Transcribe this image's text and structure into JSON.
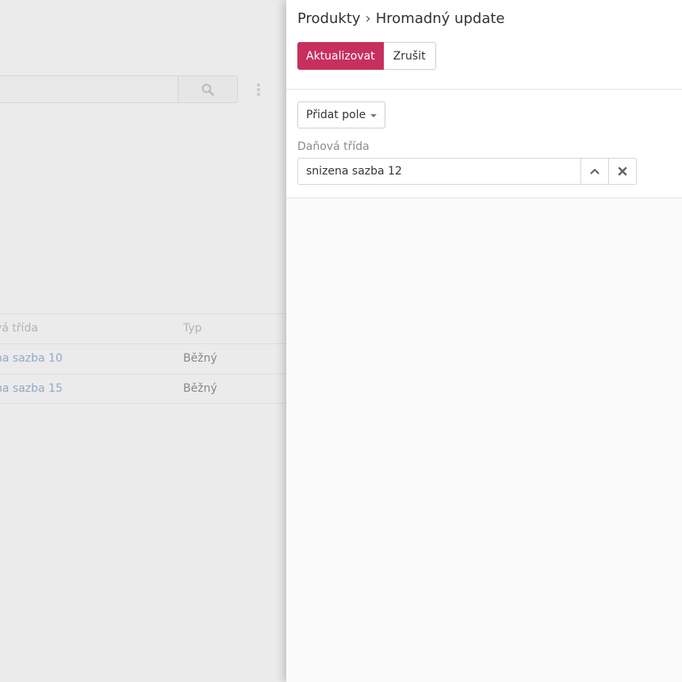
{
  "background": {
    "table": {
      "headers": {
        "tax_class": "vá třída",
        "type": "Typ"
      },
      "rows": [
        {
          "tax_class": "na sazba 10",
          "type": "Běžný"
        },
        {
          "tax_class": "na sazba 15",
          "type": "Běžný"
        }
      ]
    }
  },
  "panel": {
    "breadcrumb": {
      "parent": "Produkty",
      "separator": "›",
      "current": "Hromadný update"
    },
    "actions": {
      "update_label": "Aktualizovat",
      "cancel_label": "Zrušit"
    },
    "add_field_label": "Přidat pole",
    "field": {
      "label": "Daňová třída",
      "value": "snizena sazba 12"
    }
  },
  "colors": {
    "primary": "#c7305e",
    "link": "#8fa9c9"
  }
}
